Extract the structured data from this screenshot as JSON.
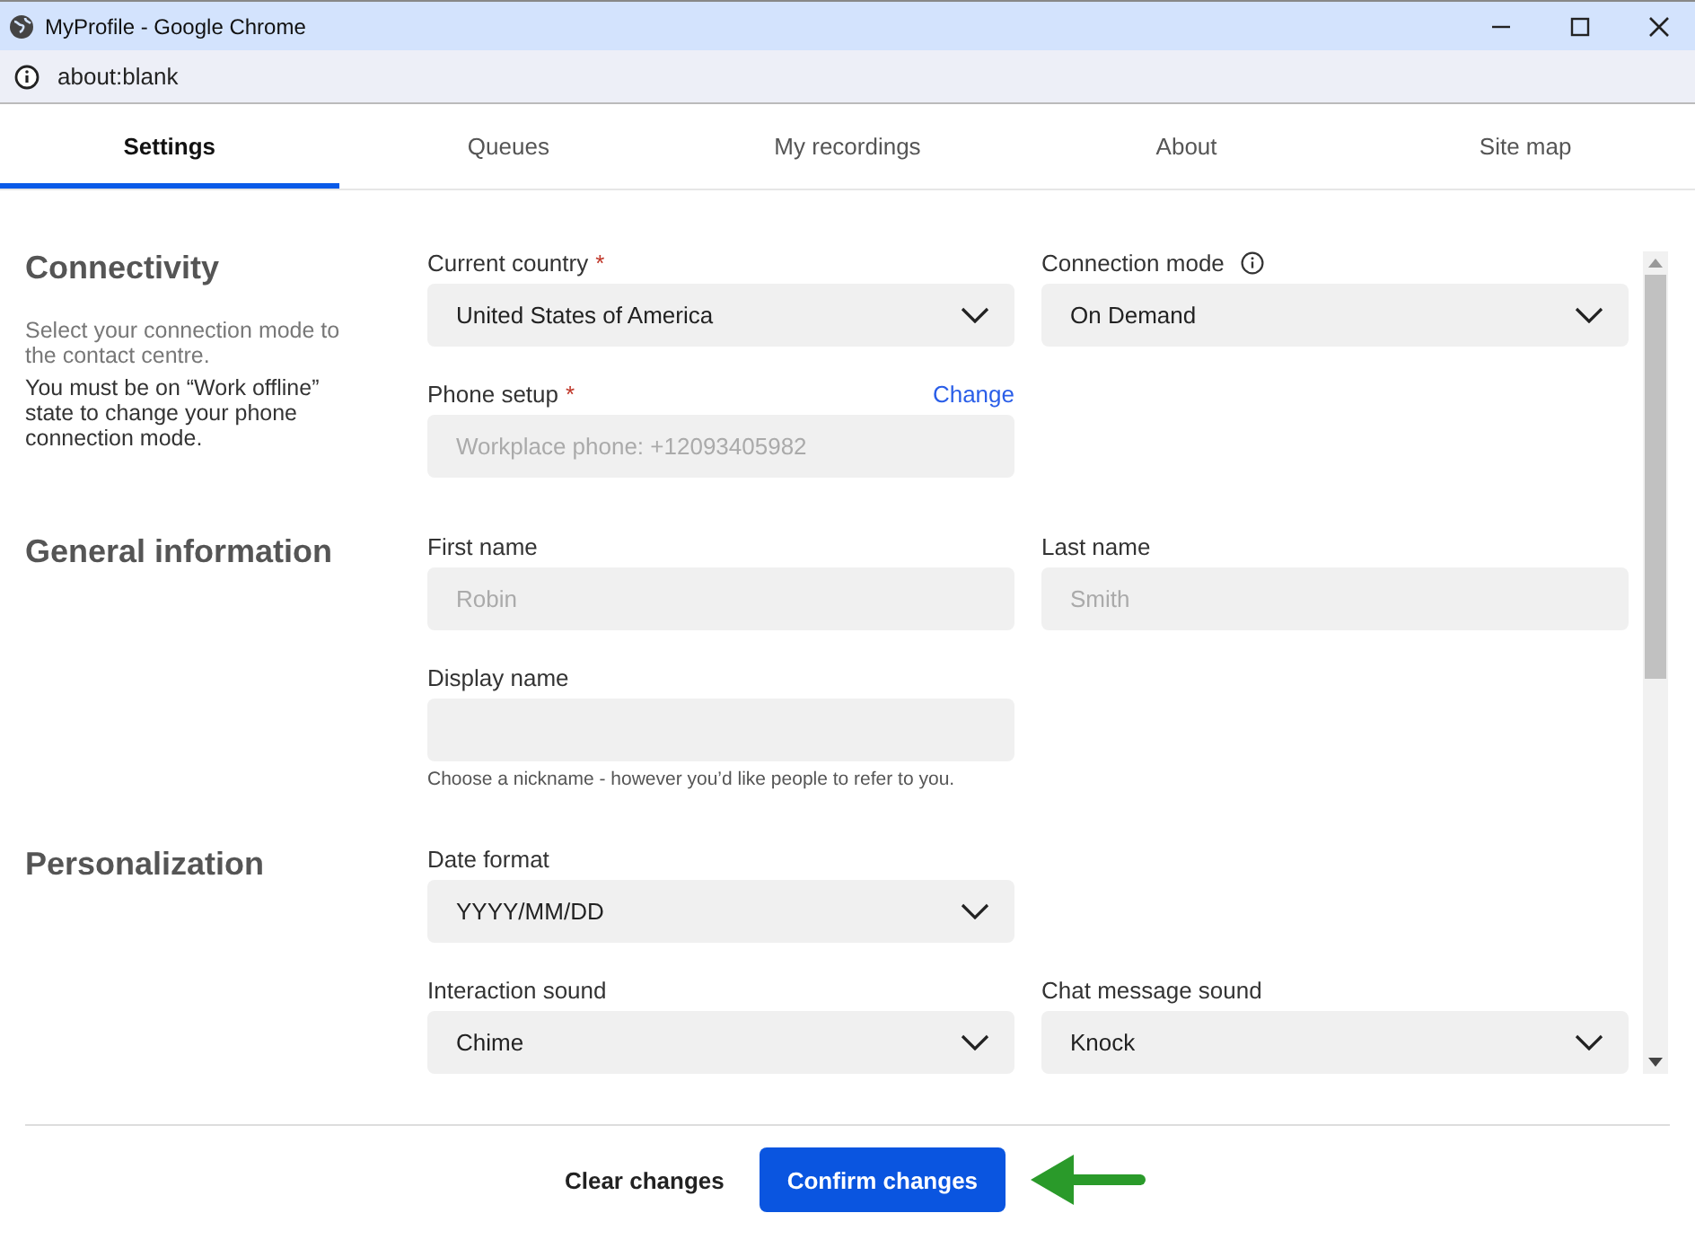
{
  "window": {
    "title": "MyProfile - Google Chrome",
    "address": "about:blank"
  },
  "tabs": [
    {
      "label": "Settings",
      "selected": true
    },
    {
      "label": "Queues",
      "selected": false
    },
    {
      "label": "My recordings",
      "selected": false
    },
    {
      "label": "About",
      "selected": false
    },
    {
      "label": "Site map",
      "selected": false
    }
  ],
  "sections": [
    {
      "title": "Connectivity",
      "description": [
        {
          "kind": "hint",
          "text": "Select your connection mode to the contact centre."
        },
        {
          "kind": "note",
          "text": "You must be on “Work offline” state to change your phone connection mode."
        }
      ],
      "rows": [
        [
          {
            "kind": "select",
            "label": "Current country",
            "required_mark": "*",
            "value": "United States of America"
          },
          {
            "kind": "select",
            "label": "Connection mode",
            "info": true,
            "value": "On Demand"
          }
        ],
        [
          {
            "kind": "input",
            "label": "Phone setup",
            "required_mark": "*",
            "action": "Change",
            "disabled": true,
            "value": "Workplace phone: +12093405982"
          }
        ]
      ]
    },
    {
      "title": "General information",
      "rows": [
        [
          {
            "kind": "input",
            "label": "First name",
            "disabled": true,
            "value": "Robin"
          },
          {
            "kind": "input",
            "label": "Last name",
            "disabled": true,
            "value": "Smith"
          }
        ],
        [
          {
            "kind": "input",
            "label": "Display name",
            "helper": "Choose a nickname - however you’d like people to refer to you."
          }
        ]
      ]
    },
    {
      "title": "Personalization",
      "rows": [
        [
          {
            "kind": "select",
            "label": "Date format",
            "value": "YYYY/MM/DD"
          }
        ],
        [
          {
            "kind": "select",
            "label": "Interaction sound",
            "value": "Chime"
          },
          {
            "kind": "select",
            "label": "Chat message sound",
            "value": "Knock"
          }
        ]
      ]
    }
  ],
  "footer": {
    "buttons": [
      {
        "kind": "secondary",
        "label": "Clear changes"
      },
      {
        "kind": "primary",
        "label": "Confirm changes"
      }
    ]
  }
}
